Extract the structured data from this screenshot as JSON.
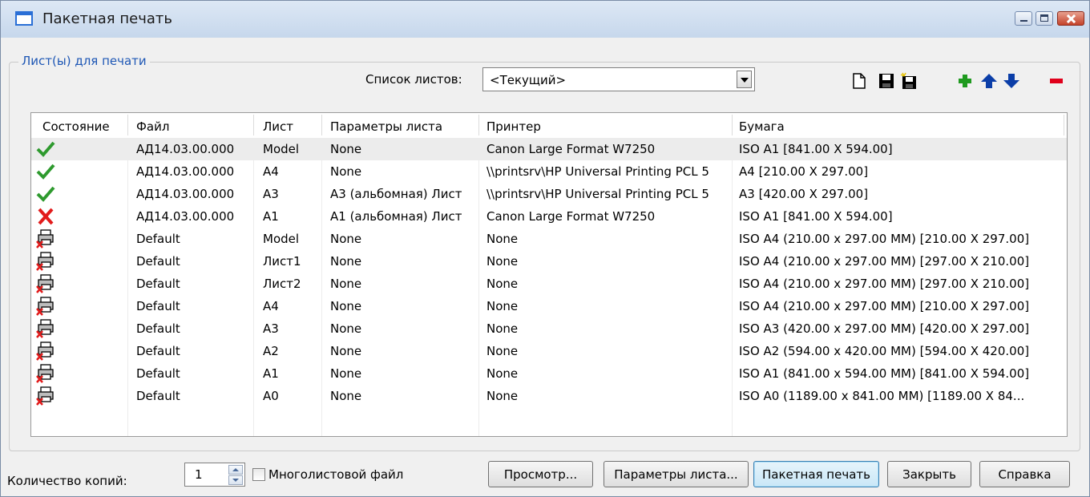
{
  "window": {
    "title": "Пакетная печать"
  },
  "group": {
    "legend": "Лист(ы) для печати"
  },
  "sheet_list": {
    "label": "Список листов:",
    "value": "<Текущий>"
  },
  "toolbar": [
    {
      "name": "new-list-icon"
    },
    {
      "name": "save-list-icon"
    },
    {
      "name": "save-as-list-icon"
    },
    {
      "name": "add-icon"
    },
    {
      "name": "move-up-icon"
    },
    {
      "name": "move-down-icon"
    },
    {
      "name": "remove-icon"
    }
  ],
  "table": {
    "headers": {
      "status": "Состояние",
      "file": "Файл",
      "sheet": "Лист",
      "params": "Параметры листа",
      "printer": "Принтер",
      "paper": "Бумага"
    },
    "rows": [
      {
        "status": "ok",
        "file": "АД14.03.00.000",
        "sheet": "Model",
        "params": "None",
        "printer": "Canon Large Format W7250",
        "paper": "ISO A1 [841.00 X 594.00]"
      },
      {
        "status": "ok",
        "file": "АД14.03.00.000",
        "sheet": "A4",
        "params": "None",
        "printer": "\\\\printsrv\\HP Universal Printing PCL 5",
        "paper": "A4 [210.00 X 297.00]"
      },
      {
        "status": "ok",
        "file": "АД14.03.00.000",
        "sheet": "A3",
        "params": "A3 (альбомная) Лист",
        "printer": "\\\\printsrv\\HP Universal Printing PCL 5",
        "paper": "A3 [420.00 X 297.00]"
      },
      {
        "status": "error",
        "file": "АД14.03.00.000",
        "sheet": "A1",
        "params": "A1 (альбомная) Лист",
        "printer": "Canon Large Format W7250",
        "paper": "ISO A1 [841.00 X 594.00]"
      },
      {
        "status": "no-printer",
        "file": "Default",
        "sheet": "Model",
        "params": "None",
        "printer": "None",
        "paper": "ISO A4 (210.00 x 297.00 MM) [210.00 X 297.00]"
      },
      {
        "status": "no-printer",
        "file": "Default",
        "sheet": "Лист1",
        "params": "None",
        "printer": "None",
        "paper": "ISO A4 (210.00 x 297.00 MM) [297.00 X 210.00]"
      },
      {
        "status": "no-printer",
        "file": "Default",
        "sheet": "Лист2",
        "params": "None",
        "printer": "None",
        "paper": "ISO A4 (210.00 x 297.00 MM) [297.00 X 210.00]"
      },
      {
        "status": "no-printer",
        "file": "Default",
        "sheet": "A4",
        "params": "None",
        "printer": "None",
        "paper": "ISO A4 (210.00 x 297.00 MM) [210.00 X 297.00]"
      },
      {
        "status": "no-printer",
        "file": "Default",
        "sheet": "A3",
        "params": "None",
        "printer": "None",
        "paper": "ISO A3 (420.00 x 297.00 MM) [420.00 X 297.00]"
      },
      {
        "status": "no-printer",
        "file": "Default",
        "sheet": "A2",
        "params": "None",
        "printer": "None",
        "paper": "ISO A2 (594.00 x 420.00 MM) [594.00 X 420.00]"
      },
      {
        "status": "no-printer",
        "file": "Default",
        "sheet": "A1",
        "params": "None",
        "printer": "None",
        "paper": "ISO A1 (841.00 x 594.00 MM) [841.00 X 594.00]"
      },
      {
        "status": "no-printer",
        "file": "Default",
        "sheet": "A0",
        "params": "None",
        "printer": "None",
        "paper": "ISO A0 (1189.00 x 841.00 MM) [1189.00 X 84..."
      }
    ]
  },
  "copies": {
    "label": "Количество копий:",
    "value": "1"
  },
  "multisheet": {
    "label": "Многолистовой файл",
    "checked": false
  },
  "buttons": {
    "preview": "Просмотр...",
    "page_setup": "Параметры листа...",
    "batch_print": "Пакетная печать",
    "close": "Закрыть",
    "help": "Справка"
  },
  "colors": {
    "legend": "#1e57b5",
    "ok": "#2e9a2e",
    "error": "#e21b1b",
    "add": "#1f9a1f",
    "arrows": "#0b3ea8",
    "remove": "#e0001b"
  }
}
